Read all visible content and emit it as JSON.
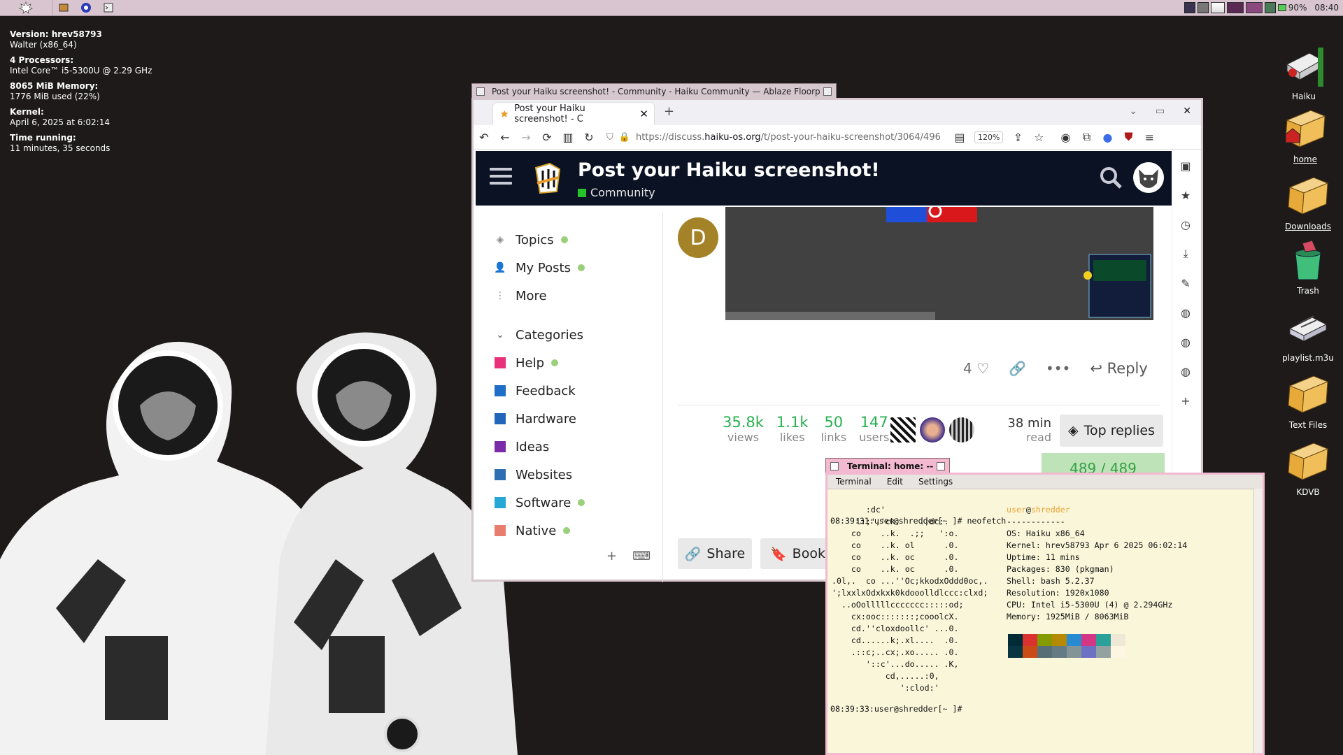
{
  "deskbar": {
    "battery": "90%",
    "clock": "08:40"
  },
  "sysinfo": {
    "version_label": "Version: hrev58793",
    "version_value": "Walter (x86_64)",
    "processors_label": "4 Processors:",
    "processors_value": "Intel Core™ i5-5300U @ 2.29 GHz",
    "memory_label": "8065 MiB Memory:",
    "memory_value": "1776 MiB used (22%)",
    "kernel_label": "Kernel:",
    "kernel_value": "April 6, 2025 at 6:02:14",
    "time_label": "Time running:",
    "time_value": "11 minutes, 35 seconds"
  },
  "desktop_icons": [
    {
      "label": "Haiku"
    },
    {
      "label": "home"
    },
    {
      "label": "Downloads"
    },
    {
      "label": "Trash"
    },
    {
      "label": "playlist.m3u"
    },
    {
      "label": "Text Files"
    },
    {
      "label": "KDVB"
    }
  ],
  "browser": {
    "window_title": "Post your Haiku screenshot! - Community - Haiku Community — Ablaze Floorp",
    "tab_title": "Post your Haiku screenshot! - C",
    "url_prefix": "https://discuss.",
    "url_host": "haiku-os.org",
    "url_path": "/t/post-your-haiku-screenshot/3064/496",
    "zoom": "120%",
    "header": {
      "title": "Post your Haiku screenshot!",
      "category": "Community"
    },
    "nav": {
      "topics": "Topics",
      "my_posts": "My Posts",
      "more": "More",
      "categories": "Categories",
      "items": [
        {
          "label": "Help",
          "color": "#e8317a",
          "dot": true
        },
        {
          "label": "Feedback",
          "color": "#1f6ec7",
          "dot": false
        },
        {
          "label": "Hardware",
          "color": "#2266bb",
          "dot": false
        },
        {
          "label": "Ideas",
          "color": "#7a2ca8",
          "dot": false
        },
        {
          "label": "Websites",
          "color": "#2c6fb2",
          "dot": false
        },
        {
          "label": "Software",
          "color": "#26a8d6",
          "dot": true
        },
        {
          "label": "Native",
          "color": "#e87d6f",
          "dot": true
        }
      ]
    },
    "post": {
      "avatar_letter": "D",
      "likes": "4",
      "reply": "Reply",
      "stats": [
        {
          "n": "35.8k",
          "l": "views"
        },
        {
          "n": "1.1k",
          "l": "likes"
        },
        {
          "n": "50",
          "l": "links"
        },
        {
          "n": "147",
          "l": "users"
        }
      ],
      "read_time": "38 min",
      "read_label": "read",
      "top_replies": "Top replies",
      "progress": "489 / 489",
      "share": "Share",
      "bookmark": "Bookm"
    }
  },
  "terminal": {
    "title": "Terminal: home: --",
    "menu": [
      "Terminal",
      "Edit",
      "Settings"
    ],
    "prompt1": "08:39:31:user@shredder[~ ]# neofetch",
    "prompt2": "08:39:33:user@shredder[~ ]#",
    "ascii": "       :dc'\n    'l:;','ck.    .;dc:.\n    co    ..k.  .;;   ':o.\n    co    ..k. ol      .0.\n    co    ..k. oc      .0.\n    co    ..k. oc      .0.\n.0l,.  co ...''Oc;kkodxOddd0oc,.\n';lxxlxOdxkxk0kdooolldlccc:clxd;\n  ..oOolllllccccccc:::::od;\n    cx:ooc:::::::;cooolcX.\n    cd.''cloxdoollc' ...0.\n    cd......k;.xl....  .0.\n    .::c;..cx;.xo..... .0.\n       '::c'...do..... .K,\n           cd,.....:0,\n              ':clod:'",
    "user": "user",
    "at": "@",
    "host": "shredder",
    "sep": "------------",
    "info": [
      "OS: Haiku x86_64",
      "Kernel: hrev58793 Apr 6 2025 06:02:14",
      "Uptime: 11 mins",
      "Packages: 830 (pkgman)",
      "Shell: bash 5.2.37",
      "Resolution: 1920x1080",
      "CPU: Intel i5-5300U (4) @ 2.294GHz",
      "Memory: 1925MiB / 8063MiB"
    ],
    "palette": [
      "#002b36",
      "#dc322f",
      "#859900",
      "#b58900",
      "#268bd2",
      "#d33682",
      "#2aa198",
      "#eee8d5",
      "#073642",
      "#cb4b16",
      "#586e75",
      "#657b83",
      "#839496",
      "#6c71c4",
      "#93a1a1",
      "#fdf6e3"
    ]
  }
}
